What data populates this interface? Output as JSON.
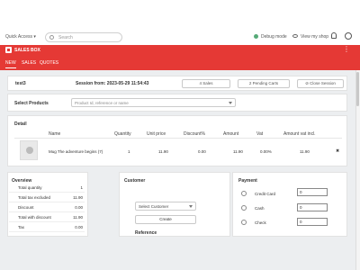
{
  "topbar": {
    "quick_access": "Quick Access ▾",
    "search_placeholder": "Search",
    "debug_mode": "Debug mode",
    "view_shop": "View my shop"
  },
  "brand": {
    "title": "SALES BOX"
  },
  "tabs": [
    {
      "label": "NEW",
      "active": true
    },
    {
      "label": "SALES",
      "active": false
    },
    {
      "label": "QUOTES",
      "active": false
    }
  ],
  "session": {
    "cart_name": "test3",
    "session_from": "Session from: 2023-05-29 11:54:43",
    "sales_button": "4 Sales",
    "pending_button": "2 Pending Carts",
    "close_button": "Close Session"
  },
  "products": {
    "label": "Select Products",
    "placeholder": "Product Id, reference or name"
  },
  "detail": {
    "title": "Detail",
    "columns": [
      "Name",
      "Quantity",
      "Unit price",
      "Discount%",
      "Amount",
      "Vat",
      "Amount vat incl."
    ],
    "rows": [
      {
        "name": "Mug The adventure begins (7)",
        "quantity": "1",
        "unit_price": "11.90",
        "discount": "0.00",
        "amount": "11.90",
        "vat": "0.00%",
        "amount_vat": "11.90"
      }
    ],
    "remove_symbol": "✖"
  },
  "overview": {
    "title": "Overview",
    "rows": [
      {
        "label": "Total quantity",
        "value": "1"
      },
      {
        "label": "Total tax excluded",
        "value": "11.90"
      },
      {
        "label": "Discount",
        "value": "0.00"
      },
      {
        "label": "Total with discount",
        "value": "11.90"
      },
      {
        "label": "Tax",
        "value": "0.00"
      }
    ]
  },
  "customer": {
    "title": "Customer",
    "select_label": "Select Customer",
    "create_label": "Create",
    "reference_label": "Reference"
  },
  "payment": {
    "title": "Payment",
    "methods": [
      {
        "label": "Credit Card",
        "value": "0"
      },
      {
        "label": "Cash",
        "value": "0"
      },
      {
        "label": "Check",
        "value": "0"
      }
    ]
  },
  "colors": {
    "accent": "#e53935",
    "background": "#eceef0"
  }
}
